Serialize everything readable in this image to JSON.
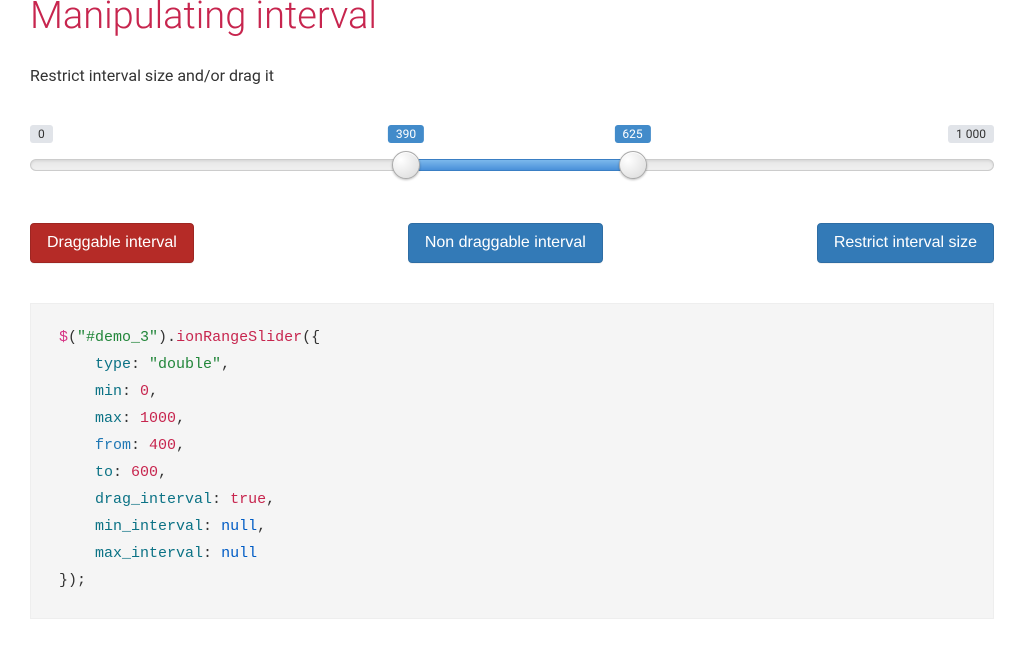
{
  "title": "Manipulating interval",
  "subtitle": "Restrict interval size and/or drag it",
  "slider": {
    "min_label": "0",
    "max_label": "1 000",
    "from_label": "390",
    "to_label": "625",
    "min": 0,
    "max": 1000,
    "from": 390,
    "to": 625
  },
  "buttons": {
    "draggable": "Draggable interval",
    "non_draggable": "Non draggable interval",
    "restrict": "Restrict interval size"
  },
  "code": {
    "selector": "\"#demo_3\"",
    "method": "ionRangeSlider",
    "opts": {
      "type_key": "type",
      "type_val": "\"double\"",
      "min_key": "min",
      "min_val": "0",
      "max_key": "max",
      "max_val": "1000",
      "from_key": "from",
      "from_val": "400",
      "to_key": "to",
      "to_val": "600",
      "drag_key": "drag_interval",
      "drag_val": "true",
      "mini_key": "min_interval",
      "mini_val": "null",
      "maxi_key": "max_interval",
      "maxi_val": "null"
    }
  }
}
